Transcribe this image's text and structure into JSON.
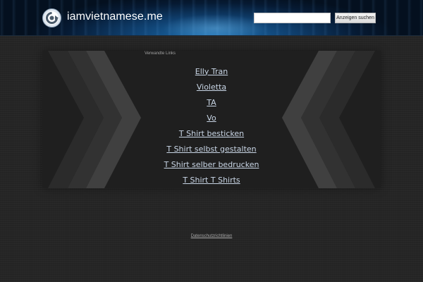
{
  "header": {
    "site_title": "iamvietnamese.me",
    "logo_icon": "circular-arrow-logo-icon",
    "search": {
      "value": "",
      "placeholder": "",
      "button_label": "Anzeigen suchen"
    }
  },
  "main": {
    "heading": "Verwandte Links",
    "links": [
      "Elly Tran",
      "Violetta",
      "TA",
      "Vo",
      "T Shirt besticken",
      "T Shirt selbst gestalten",
      "T Shirt selber bedrucken",
      "T Shirt T Shirts"
    ]
  },
  "footer": {
    "privacy_label": "Datenschutzrichtlinien"
  },
  "colors": {
    "page_background": "#252525",
    "panel_background": "#1f1f1f",
    "link_color": "#c9d6e6",
    "header_blue": "#0f3f6e"
  }
}
